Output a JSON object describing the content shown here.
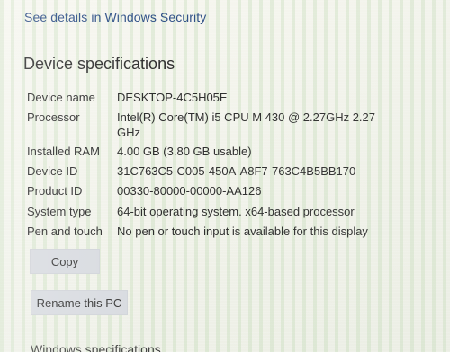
{
  "top_link": {
    "label": "See details in Windows Security"
  },
  "device_specifications": {
    "title": "Device specifications",
    "rows": [
      {
        "label": "Device name",
        "value": "DESKTOP-4C5H05E"
      },
      {
        "label": "Processor",
        "value": "Intel(R) Core(TM) i5 CPU       M 430  @ 2.27GHz   2.27",
        "value_line2": "GHz"
      },
      {
        "label": "Installed RAM",
        "value": "4.00 GB (3.80 GB usable)"
      },
      {
        "label": "Device ID",
        "value": "31C763C5-C005-450A-A8F7-763C4B5BB170"
      },
      {
        "label": "Product ID",
        "value": "00330-80000-00000-AA126"
      },
      {
        "label": "System type",
        "value": "64-bit operating system. x64-based processor"
      },
      {
        "label": "Pen and touch",
        "value": "No pen or touch input is available for this display"
      }
    ]
  },
  "buttons": {
    "copy": "Copy",
    "rename": "Rename this PC"
  },
  "bottom_partial": {
    "text": "Windows specifications"
  }
}
